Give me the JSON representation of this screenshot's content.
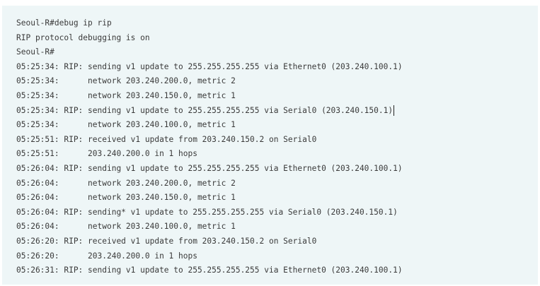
{
  "terminal": {
    "lines": [
      "Seoul-R#debug ip rip",
      "RIP protocol debugging is on",
      "Seoul-R#",
      "05:25:34: RIP: sending v1 update to 255.255.255.255 via Ethernet0 (203.240.100.1)",
      "05:25:34:      network 203.240.200.0, metric 2",
      "05:25:34:      network 203.240.150.0, metric 1",
      "05:25:34: RIP: sending v1 update to 255.255.255.255 via Serial0 (203.240.150.1)",
      "05:25:34:      network 203.240.100.0, metric 1",
      "05:25:51: RIP: received v1 update from 203.240.150.2 on Serial0",
      "05:25:51:      203.240.200.0 in 1 hops",
      "05:26:04: RIP: sending v1 update to 255.255.255.255 via Ethernet0 (203.240.100.1)",
      "05:26:04:      network 203.240.200.0, metric 2",
      "05:26:04:      network 203.240.150.0, metric 1",
      "05:26:04: RIP: sending* v1 update to 255.255.255.255 via Serial0 (203.240.150.1)",
      "05:26:04:      network 203.240.100.0, metric 1",
      "05:26:20: RIP: received v1 update from 203.240.150.2 on Serial0",
      "05:26:20:      203.240.200.0 in 1 hops",
      "05:26:31: RIP: sending v1 update to 255.255.255.255 via Ethernet0 (203.240.100.1)"
    ]
  }
}
